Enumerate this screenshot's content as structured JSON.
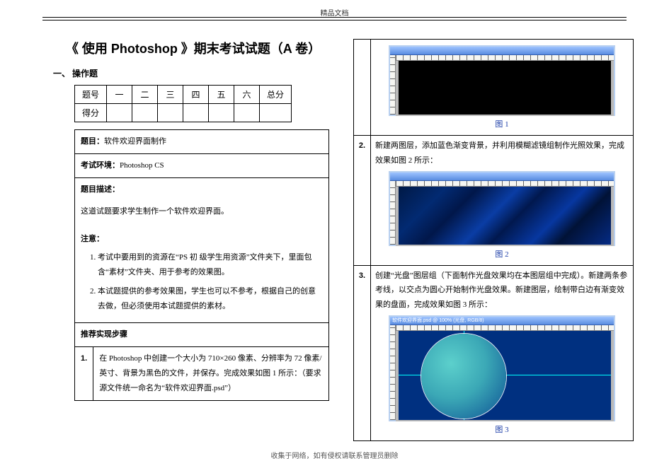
{
  "header_label": "精品文档",
  "title": "《    使用 Photoshop    》期末考试试题（A 卷）",
  "section_one": "一、  操作题",
  "score_table": {
    "row_head": "题号",
    "cols": [
      "一",
      "二",
      "三",
      "四",
      "五",
      "六",
      "总分"
    ],
    "row_score": "得分"
  },
  "instr": {
    "topic_label": "题目：",
    "topic_value": "软件欢迎界面制作",
    "env_label": "考试环境：",
    "env_value": "Photoshop CS",
    "desc_label": "题目描述：",
    "desc_body": "这道试题要求学生制作一个软件欢迎界面。",
    "note_label": "注意：",
    "notes": [
      "考试中要用到的资源在“PS 初  级学生用资源”文件夹下，里面包含“素材”文件夹、用于参考的效果图。",
      "本试题提供的参考效果图，学生也可以不参考，根据自己的创意去做，但必须使用本试题提供的素材。"
    ],
    "steps_label": "推荐实现步骤",
    "step1_num": "1.",
    "step1_body": "在 Photoshop 中创建一个大小为 710×260 像素、分辨率为 72 像素/英寸、背景为黑色的文件，并保存。完成效果如图 1 所示：（要求源文件统一命名为“软件欢迎界面.psd”）"
  },
  "right": {
    "fig1_caption": "图 1",
    "step2_num": "2.",
    "step2_body": "新建两图层，添加蓝色渐变背景，并利用模糊滤镜组制作光照效果，完成效果如图 2 所示：",
    "fig2_caption": "图 2",
    "step3_num": "3.",
    "step3_body": "创建“光盘”图层组（下面制作光盘效果均在本图层组中完成）。新建两条参考线，以交点为圆心开始制作光盘效果。新建图层，绘制带白边有渐变效果的盘面，完成效果如图 3 所示：",
    "fig3_title": "软件欢迎界面.psd @ 100% (光盘, RGB/8)",
    "fig3_caption": "图 3"
  },
  "footer": "收集于网络，如有侵权请联系管理员删除"
}
